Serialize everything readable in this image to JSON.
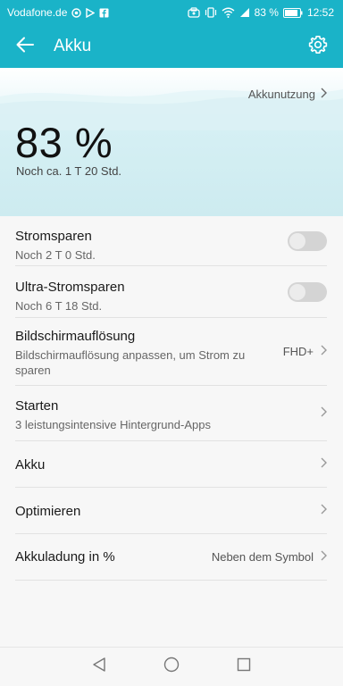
{
  "status_bar": {
    "carrier": "Vodafone.de",
    "battery_percent": "83 %",
    "time": "12:52"
  },
  "app_bar": {
    "title": "Akku"
  },
  "hero": {
    "usage_link": "Akkunutzung",
    "battery_level": "83 %",
    "remaining": "Noch ca. 1 T 20 Std."
  },
  "list": {
    "power_saving": {
      "title": "Stromsparen",
      "subtitle": "Noch 2 T 0 Std.",
      "enabled": false
    },
    "ultra_power_saving": {
      "title": "Ultra-Stromsparen",
      "subtitle": "Noch 6 T 18 Std.",
      "enabled": false
    },
    "resolution": {
      "title": "Bildschirmauflösung",
      "subtitle": "Bildschirmauflösung anpassen, um Strom zu sparen",
      "value": "FHD+"
    },
    "launch": {
      "title": "Starten",
      "subtitle": "3 leistungsintensive Hintergrund-Apps"
    },
    "battery": {
      "title": "Akku"
    },
    "optimize": {
      "title": "Optimieren"
    },
    "percentage": {
      "title": "Akkuladung in %",
      "value": "Neben dem Symbol"
    }
  },
  "icons": {
    "back": "arrow-left-icon",
    "settings": "gear-icon",
    "chevron": "chevron-right-icon",
    "nav_back": "triangle-back-icon",
    "nav_home": "circle-home-icon",
    "nav_recent": "square-recent-icon"
  },
  "colors": {
    "accent": "#1ab3c8",
    "hero_bg": "#cdebf0",
    "toggle_off": "#d4d4d4"
  }
}
